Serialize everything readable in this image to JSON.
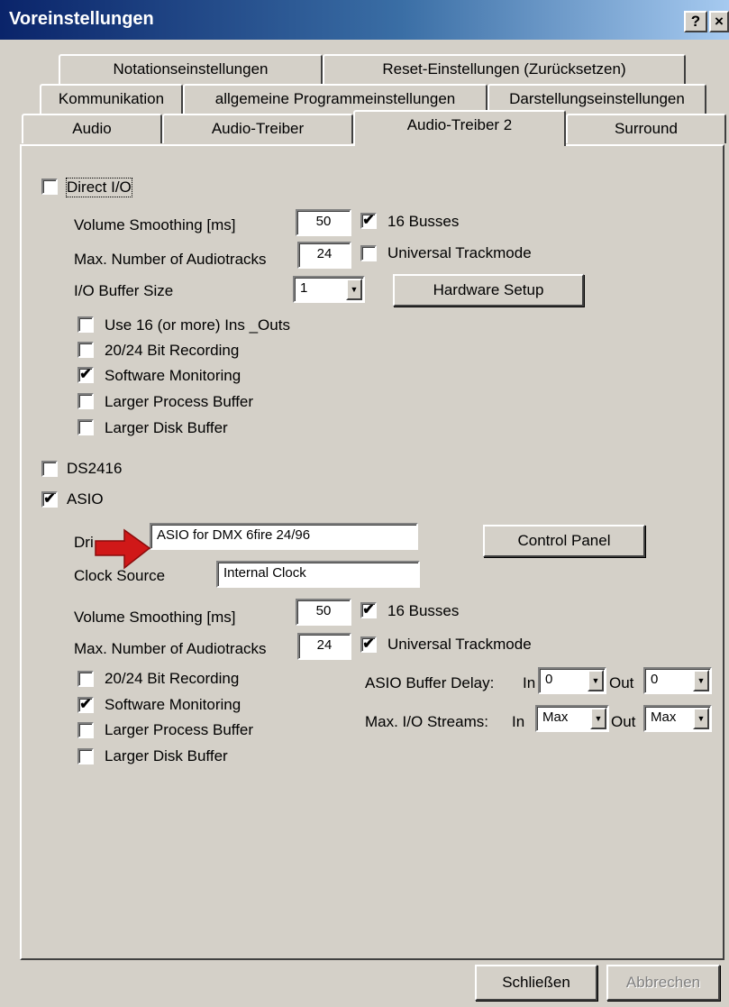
{
  "window": {
    "title": "Voreinstellungen",
    "help_button": "?",
    "close_button": "×"
  },
  "tabs": {
    "row1": [
      "Notationseinstellungen",
      "Reset-Einstellungen (Zurücksetzen)"
    ],
    "row2": [
      "Kommunikation",
      "allgemeine Programmeinstellungen",
      "Darstellungseinstellungen"
    ],
    "row3": [
      "Audio",
      "Audio-Treiber",
      "Audio-Treiber 2",
      "Surround"
    ],
    "active": "Audio-Treiber 2"
  },
  "direct_io": {
    "label": "Direct I/O",
    "checked": false,
    "volume_smoothing_label": "Volume Smoothing [ms]",
    "volume_smoothing_value": "50",
    "max_tracks_label": "Max. Number of Audiotracks",
    "max_tracks_value": "24",
    "busses_label": "16 Busses",
    "busses_mark": "✔",
    "universal_trackmode_label": "Universal Trackmode",
    "universal_trackmode_mark": "",
    "io_buffer_label": "I/O Buffer Size",
    "io_buffer_value": "1",
    "hardware_setup_button": "Hardware Setup",
    "options": [
      {
        "label": "Use 16 (or more) Ins _Outs",
        "mark": ""
      },
      {
        "label": "20/24 Bit Recording",
        "mark": ""
      },
      {
        "label": "Software Monitoring",
        "mark": "✔"
      },
      {
        "label": "Larger Process Buffer",
        "mark": ""
      },
      {
        "label": "Larger Disk Buffer",
        "mark": ""
      }
    ]
  },
  "ds2416": {
    "label": "DS2416",
    "mark": ""
  },
  "asio": {
    "label": "ASIO",
    "mark": "✔",
    "driver_label": "Dri",
    "driver_value": "ASIO for DMX 6fire 24/96",
    "control_panel_button": "Control Panel",
    "clock_source_label": "Clock Source",
    "clock_source_value": "Internal Clock",
    "volume_smoothing_label": "Volume Smoothing [ms]",
    "volume_smoothing_value": "50",
    "busses_label": "16 Busses",
    "busses_mark": "✔",
    "max_tracks_label": "Max. Number of Audiotracks",
    "max_tracks_value": "24",
    "universal_trackmode_label": "Universal Trackmode",
    "universal_trackmode_mark": "✔",
    "options": [
      {
        "label": "20/24 Bit Recording",
        "mark": ""
      },
      {
        "label": "Software Monitoring",
        "mark": "✔"
      },
      {
        "label": "Larger Process Buffer",
        "mark": ""
      },
      {
        "label": "Larger Disk Buffer",
        "mark": ""
      }
    ],
    "buffer_delay_label": "ASIO Buffer Delay:",
    "buffer_delay_in_label": "In",
    "buffer_delay_in_value": "0",
    "buffer_delay_out_label": "Out",
    "buffer_delay_out_value": "0",
    "io_streams_label": "Max. I/O Streams:",
    "io_streams_in_label": "In",
    "io_streams_in_value": "Max",
    "io_streams_out_label": "Out",
    "io_streams_out_value": "Max"
  },
  "footer": {
    "close_button": "Schließen",
    "cancel_button": "Abbrechen"
  },
  "colors": {
    "titlebar_start": "#0a246a",
    "titlebar_end": "#a6caf0",
    "face": "#d4d0c8",
    "arrow": "#d01818"
  }
}
